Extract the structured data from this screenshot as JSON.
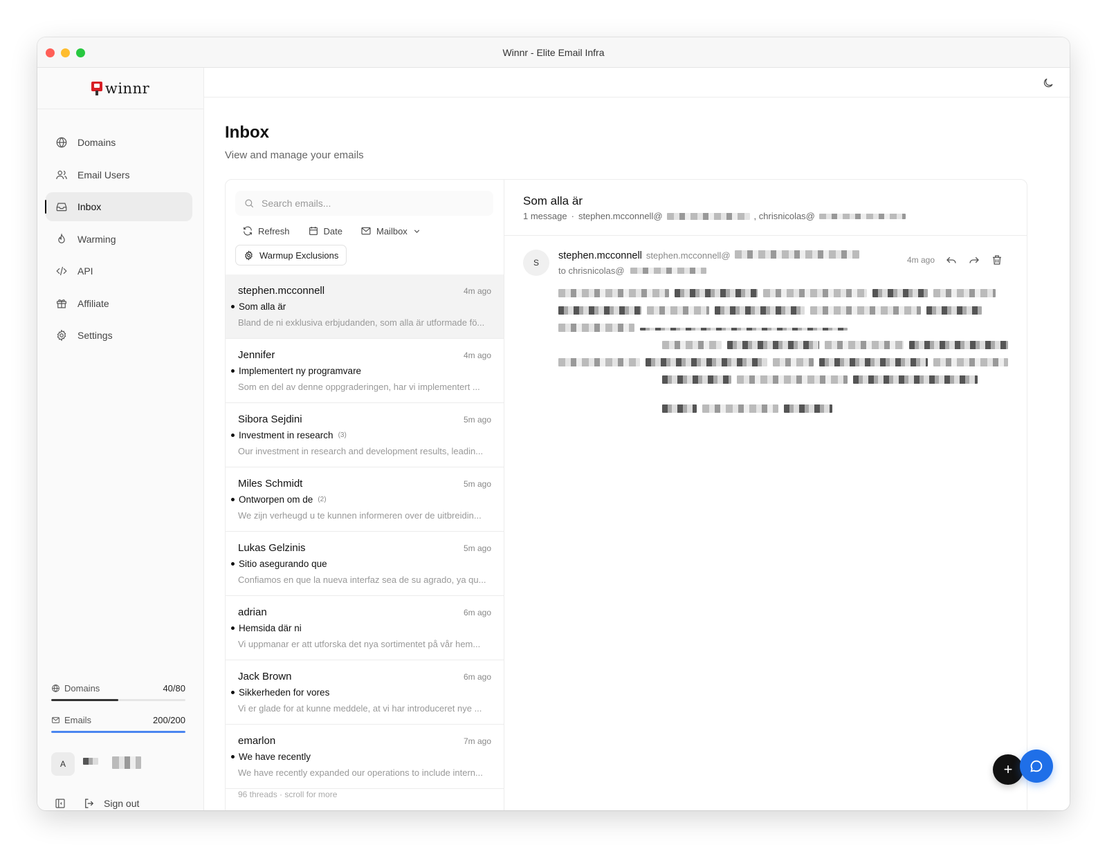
{
  "window": {
    "title": "Winnr - Elite Email Infra"
  },
  "brand": {
    "name": "winnr",
    "accent": "#d81f26"
  },
  "sidebar": {
    "items": [
      {
        "label": "Domains",
        "icon": "globe-icon"
      },
      {
        "label": "Email Users",
        "icon": "users-icon"
      },
      {
        "label": "Inbox",
        "icon": "inbox-icon",
        "active": true
      },
      {
        "label": "Warming",
        "icon": "flame-icon"
      },
      {
        "label": "API",
        "icon": "code-icon"
      },
      {
        "label": "Affiliate",
        "icon": "gift-icon"
      },
      {
        "label": "Settings",
        "icon": "gear-icon"
      }
    ],
    "usage": {
      "domains": {
        "label": "Domains",
        "value": "40/80",
        "fraction": 0.5,
        "color": "#333333"
      },
      "emails": {
        "label": "Emails",
        "value": "200/200",
        "fraction": 1.0,
        "color": "#4a86f0"
      }
    },
    "account": {
      "avatar_initial": "A"
    },
    "sign_out": "Sign out"
  },
  "page": {
    "title": "Inbox",
    "subtitle": "View and manage your emails"
  },
  "list": {
    "search_placeholder": "Search emails...",
    "toolbar": {
      "refresh": "Refresh",
      "date": "Date",
      "mailbox": "Mailbox"
    },
    "warmup_button": "Warmup Exclusions",
    "threads": [
      {
        "name": "stephen.mcconnell",
        "time": "4m ago",
        "subject": "Som alla är",
        "count": "",
        "preview": "Bland de ni exklusiva erbjudanden, som alla är utformade fö...",
        "selected": true
      },
      {
        "name": "Jennifer",
        "time": "4m ago",
        "subject": "Implementert ny programvare",
        "count": "",
        "preview": "Som en del av denne oppgraderingen, har vi implementert ..."
      },
      {
        "name": "Sibora Sejdini",
        "time": "5m ago",
        "subject": "Investment in research",
        "count": "(3)",
        "preview": "Our investment in research and development results, leadin..."
      },
      {
        "name": "Miles Schmidt",
        "time": "5m ago",
        "subject": "Ontworpen om de",
        "count": "(2)",
        "preview": "We zijn verheugd u te kunnen informeren over de uitbreidin..."
      },
      {
        "name": "Lukas Gelzinis",
        "time": "5m ago",
        "subject": "Sitio asegurando que",
        "count": "",
        "preview": "Confiamos en que la nueva interfaz sea de su agrado, ya qu..."
      },
      {
        "name": "adrian",
        "time": "6m ago",
        "subject": "Hemsida där ni",
        "count": "",
        "preview": "Vi uppmanar er att utforska det nya sortimentet på vår hem..."
      },
      {
        "name": "Jack Brown",
        "time": "6m ago",
        "subject": "Sikkerheden for vores",
        "count": "",
        "preview": "Vi er glade for at kunne meddele, at vi har introduceret nye ..."
      },
      {
        "name": "emarlon",
        "time": "7m ago",
        "subject": "We have recently",
        "count": "",
        "preview": "We have recently expanded our operations to include intern..."
      }
    ],
    "footnote": "96 threads · scroll for more"
  },
  "detail": {
    "subject": "Som alla är",
    "message_count": "1 message",
    "participant_1": "stephen.mcconnell@",
    "participant_2": ", chrisnicolas@",
    "message": {
      "avatar_initial": "S",
      "from_name": "stephen.mcconnell",
      "from_address": "stephen.mcconnell@",
      "to": "to chrisnicolas@",
      "time": "4m ago"
    }
  }
}
